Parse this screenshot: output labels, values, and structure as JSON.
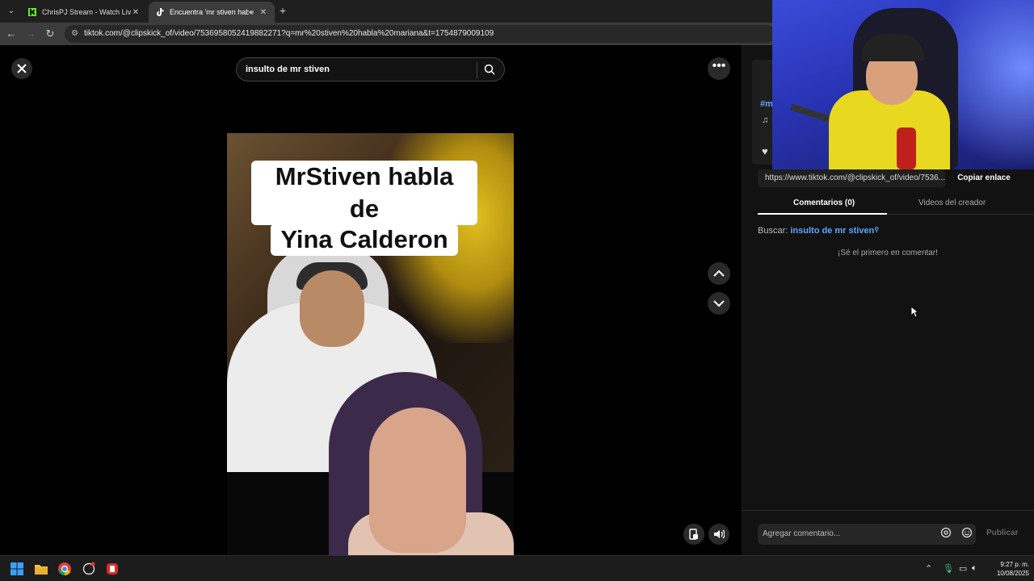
{
  "browser": {
    "tabs": [
      {
        "title": "ChrisPJ Stream - Watch Live on",
        "favicon": "kick-icon",
        "color": "#53fc18"
      },
      {
        "title": "Encuentra 'mr stiven habla",
        "favicon": "tiktok-icon",
        "active": true
      }
    ],
    "url": "tiktok.com/@clipskick_of/video/7536958052419882271?q=mr%20stiven%20habla%20mariana&t=1754879009109"
  },
  "video": {
    "search_value": "insulto de mr stiven",
    "caption_line1": "MrStiven habla de",
    "caption_line2": "Yina Calderon"
  },
  "side": {
    "hashtag": "#m",
    "link_text": "https://www.tiktok.com/@clipskick_of/video/7536...",
    "copy_label": "Copiar enlace",
    "tab_comments": "Comentarios (0)",
    "tab_creator": "Videos del creador",
    "search_prefix": "Buscar:",
    "search_query": "insulto de mr stiven",
    "empty_message": "¡Sé el primero en comentar!",
    "comment_placeholder": "Agregar comentario...",
    "publish_label": "Publicar"
  },
  "taskbar": {
    "time": "9:27 p. m.",
    "date": "10/08/2025"
  },
  "colors": {
    "accent_link": "#5fa6ff",
    "page_bg": "#000000",
    "panel_bg": "#121212"
  }
}
